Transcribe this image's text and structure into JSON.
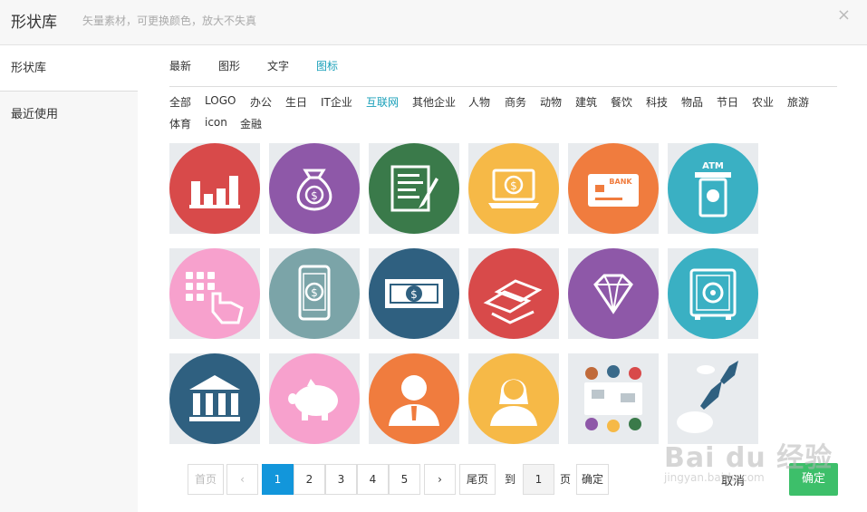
{
  "header": {
    "title": "形状库",
    "subtitle": "矢量素材，可更换颜色，放大不失真",
    "close_glyph": "×"
  },
  "sidebar": {
    "items": [
      {
        "label": "形状库"
      },
      {
        "label": "最近使用"
      }
    ]
  },
  "tabs": [
    {
      "label": "最新"
    },
    {
      "label": "图形"
    },
    {
      "label": "文字"
    },
    {
      "label": "图标"
    }
  ],
  "active_tab": "图标",
  "categories": [
    {
      "label": "全部"
    },
    {
      "label": "LOGO"
    },
    {
      "label": "办公"
    },
    {
      "label": "生日"
    },
    {
      "label": "IT企业"
    },
    {
      "label": "互联网"
    },
    {
      "label": "其他企业"
    },
    {
      "label": "人物"
    },
    {
      "label": "商务"
    },
    {
      "label": "动物"
    },
    {
      "label": "建筑"
    },
    {
      "label": "餐饮"
    },
    {
      "label": "科技"
    },
    {
      "label": "物品"
    },
    {
      "label": "节日"
    },
    {
      "label": "农业"
    },
    {
      "label": "旅游"
    },
    {
      "label": "体育"
    },
    {
      "label": "icon"
    },
    {
      "label": "金融"
    }
  ],
  "active_category": "互联网",
  "icons": [
    {
      "name": "bar-chart-icon",
      "color": "#d84a4a"
    },
    {
      "name": "money-bag-icon",
      "color": "#8e58a8"
    },
    {
      "name": "contract-pen-icon",
      "color": "#3a7a4a"
    },
    {
      "name": "laptop-coin-icon",
      "color": "#f6b947"
    },
    {
      "name": "bank-card-icon",
      "color": "#f07c3e"
    },
    {
      "name": "atm-icon",
      "color": "#3ab0c3",
      "label": "ATM"
    },
    {
      "name": "keypad-hand-icon",
      "color": "#f7a1cd"
    },
    {
      "name": "mobile-payment-icon",
      "color": "#7ba4a8"
    },
    {
      "name": "banknote-icon",
      "color": "#2f6080"
    },
    {
      "name": "gold-bars-icon",
      "color": "#d84a4a"
    },
    {
      "name": "diamond-icon",
      "color": "#8e58a8"
    },
    {
      "name": "safe-icon",
      "color": "#3ab0c3"
    },
    {
      "name": "bank-building-icon",
      "color": "#2f6080"
    },
    {
      "name": "piggy-bank-icon",
      "color": "#f7a1cd"
    },
    {
      "name": "businessman-icon",
      "color": "#f07c3e"
    },
    {
      "name": "businesswoman-icon",
      "color": "#f6b947"
    },
    {
      "name": "team-meeting-illustration-icon",
      "color": "#e8ebee"
    },
    {
      "name": "rocket-launch-illustration-icon",
      "color": "#e8ebee"
    }
  ],
  "pagination": {
    "first": "首页",
    "prev": "‹",
    "pages": [
      "1",
      "2",
      "3",
      "4",
      "5"
    ],
    "current": "1",
    "next": "›",
    "last": "尾页",
    "goto_label": "到",
    "page_input": "1",
    "page_unit": "页",
    "go": "确定"
  },
  "footer": {
    "cancel": "取消",
    "confirm": "确定"
  },
  "watermark": {
    "main": "Bai du 经验",
    "sub": "jingyan.baidu.com"
  }
}
